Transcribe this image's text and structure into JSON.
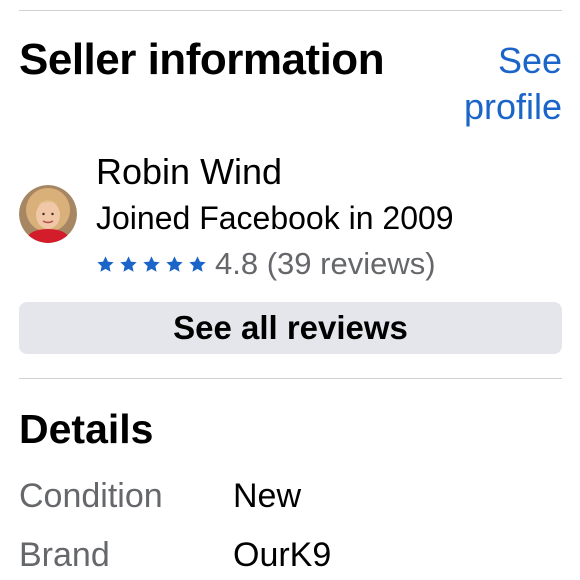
{
  "seller": {
    "heading": "Seller information",
    "see_profile_label": "See profile",
    "name": "Robin Wind",
    "joined": "Joined Facebook in 2009",
    "rating": {
      "stars": 5,
      "text": "4.8 (39 reviews)"
    },
    "see_all_reviews_label": "See all reviews"
  },
  "details": {
    "heading": "Details",
    "rows": [
      {
        "label": "Condition",
        "value": "New"
      },
      {
        "label": "Brand",
        "value": "OurK9"
      }
    ]
  },
  "colors": {
    "link": "#1b65c9",
    "star": "#1b65c9",
    "button_bg": "#e4e6eb",
    "muted_text": "#65676b"
  },
  "icons": {
    "star": "star-icon",
    "avatar": "avatar"
  }
}
